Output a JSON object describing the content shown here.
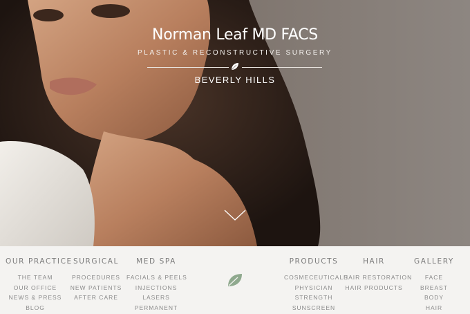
{
  "brand": {
    "name": "Norman Leaf MD FACS",
    "tagline": "PLASTIC & RECONSTRUCTIVE SURGERY",
    "location": "BEVERLY HILLS"
  },
  "icons": {
    "brand_leaf": "leaf-icon",
    "scroll": "chevron-down-icon",
    "nav_leaf": "leaf-icon"
  },
  "colors": {
    "leaf_green": "#8fa98e",
    "nav_text": "#8a8a8a",
    "nav_title": "#7b7b7b",
    "nav_bg": "#f4f3f1"
  },
  "nav": {
    "practice": {
      "title": "OUR PRACTICE",
      "items": [
        "THE TEAM",
        "OUR OFFICE",
        "NEWS & PRESS",
        "BLOG"
      ]
    },
    "surgical": {
      "title": "SURGICAL",
      "items": [
        "PROCEDURES",
        "NEW PATIENTS",
        "AFTER CARE"
      ]
    },
    "medspa": {
      "title": "MED SPA",
      "items": [
        "FACIALS & PEELS",
        "INJECTIONS",
        "LASERS",
        "PERMANENT"
      ]
    },
    "products": {
      "title": "PRODUCTS",
      "items": [
        "COSMECEUTICALS",
        "PHYSICIAN",
        "STRENGTH",
        "SUNSCREEN"
      ]
    },
    "hair": {
      "title": "HAIR",
      "items": [
        "HAIR RESTORATION",
        "HAIR PRODUCTS"
      ]
    },
    "gallery": {
      "title": "GALLERY",
      "items": [
        "FACE",
        "BREAST",
        "BODY",
        "HAIR"
      ]
    }
  }
}
